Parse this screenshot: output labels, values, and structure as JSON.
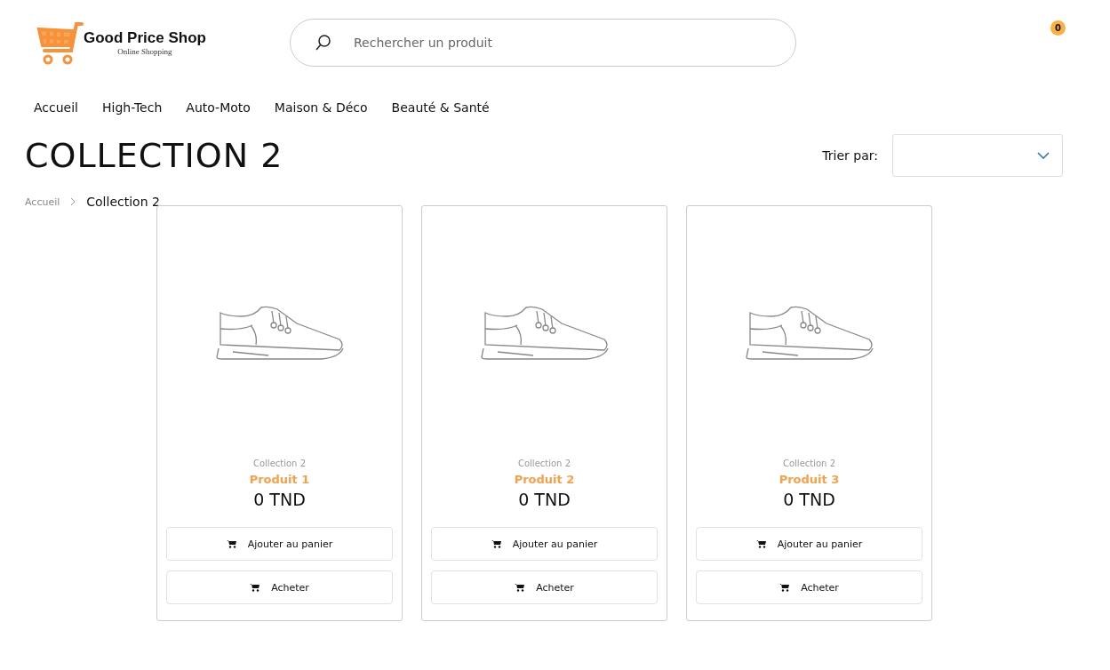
{
  "logo": {
    "name": "Good Price Shop",
    "tagline": "Online Shopping"
  },
  "search": {
    "placeholder": "Rechercher un produit"
  },
  "cart": {
    "count": "0"
  },
  "nav": [
    "Accueil",
    "High-Tech",
    "Auto-Moto",
    "Maison & Déco",
    "Beauté & Santé"
  ],
  "page_title": "COLLECTION 2",
  "sort": {
    "label": "Trier par:"
  },
  "breadcrumb": [
    "Accueil",
    "Collection 2"
  ],
  "products": [
    {
      "collection": "Collection 2",
      "name": "Produit 1",
      "price": "0 TND",
      "buttons": [
        "Ajouter au panier",
        "Acheter"
      ]
    },
    {
      "collection": "Collection 2",
      "name": "Produit 2",
      "price": "0 TND",
      "buttons": [
        "Ajouter au panier",
        "Acheter"
      ]
    },
    {
      "collection": "Collection 2",
      "name": "Produit 3",
      "price": "0 TND",
      "buttons": [
        "Ajouter au panier",
        "Acheter"
      ]
    }
  ]
}
